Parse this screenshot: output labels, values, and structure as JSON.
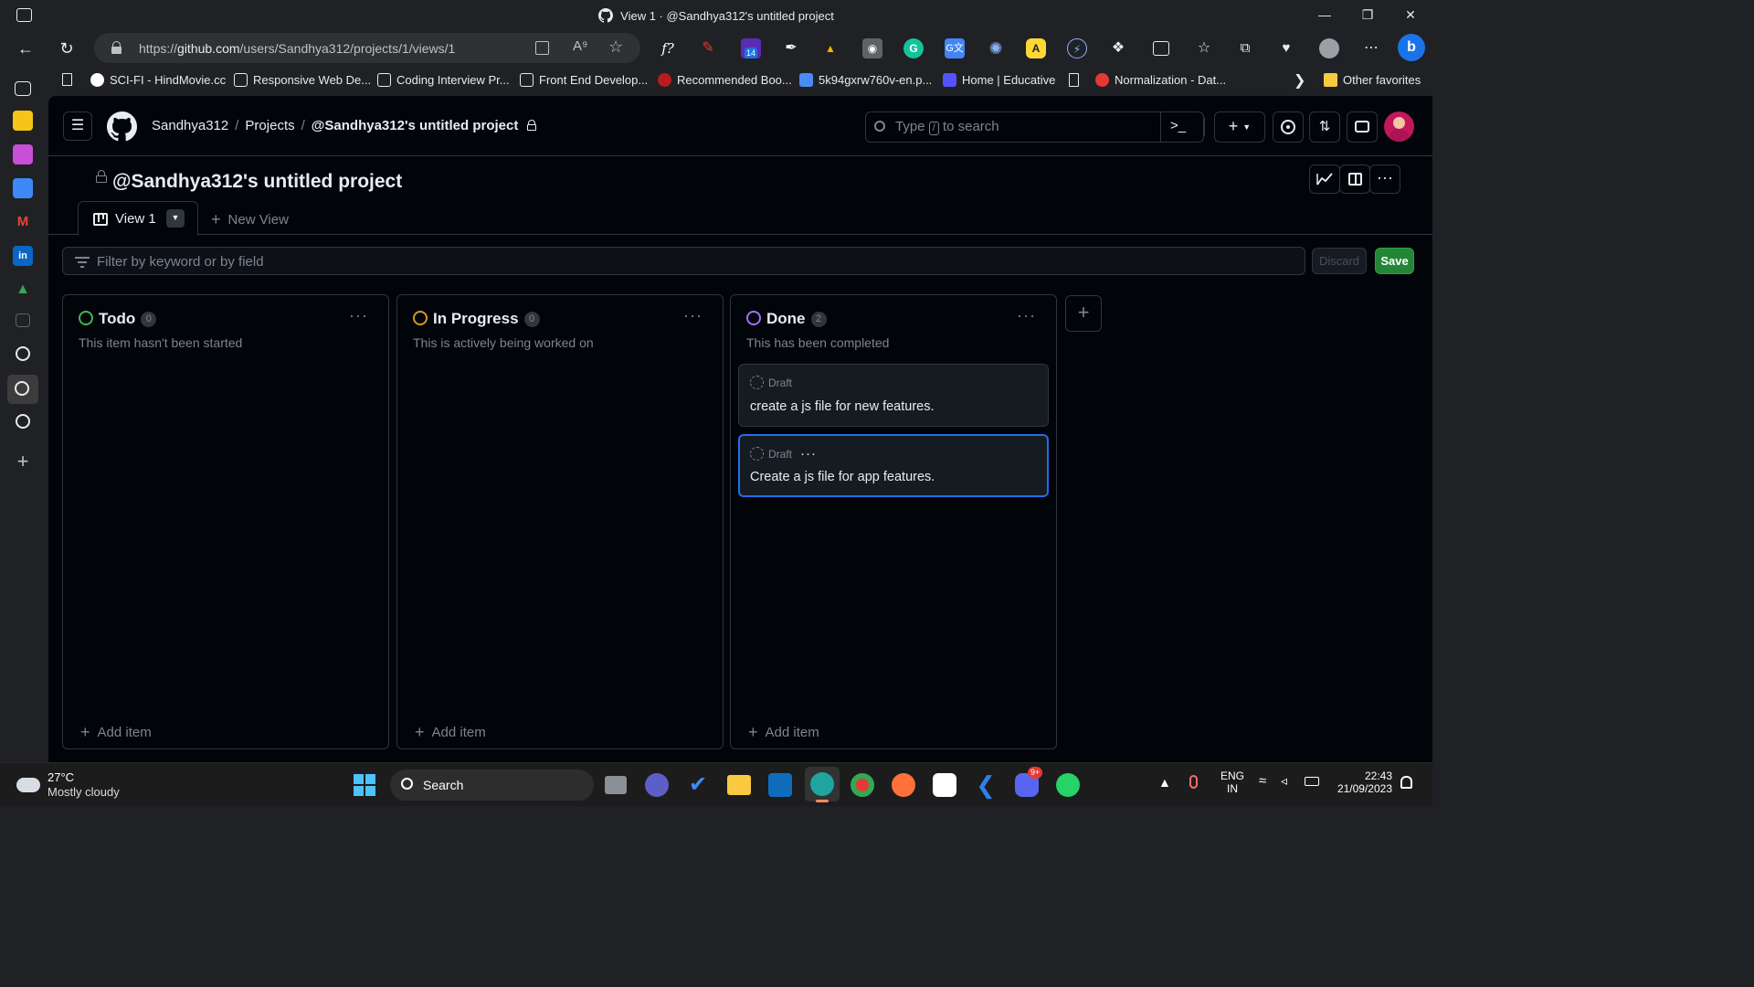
{
  "browser": {
    "tab_title": "View 1 · @Sandhya312's untitled project",
    "url_prefix": "https://",
    "url_host": "github.com",
    "url_path": "/users/Sandhya312/projects/1/views/1",
    "extension_badge": "14",
    "bookmarks": [
      "SCI-FI - HindMovie.cc",
      "Responsive Web De...",
      "Coding Interview Pr...",
      "Front End Develop...",
      "Recommended Boo...",
      "5k94gxrw760v-en.p...",
      "Home | Educative",
      "Normalization - Dat..."
    ],
    "other_favorites": "Other favorites"
  },
  "github": {
    "breadcrumb": {
      "owner": "Sandhya312",
      "section": "Projects",
      "project": "@Sandhya312's untitled project"
    },
    "search": {
      "prefix": "Type",
      "key": "/",
      "suffix": "to search"
    },
    "project_title": "@Sandhya312's untitled project",
    "tabs": {
      "view1": "View 1",
      "new_view": "New View"
    },
    "filter_placeholder": "Filter by keyword or by field",
    "discard_label": "Discard",
    "save_label": "Save",
    "columns": [
      {
        "name": "Todo",
        "count": "0",
        "description": "This item hasn't been started",
        "color": "#3fb950",
        "add_label": "Add item"
      },
      {
        "name": "In Progress",
        "count": "0",
        "description": "This is actively being worked on",
        "color": "#d29922",
        "add_label": "Add item"
      },
      {
        "name": "Done",
        "count": "2",
        "description": "This has been completed",
        "color": "#a371f7",
        "add_label": "Add item",
        "cards": [
          {
            "label": "Draft",
            "text": "create a js file for new features."
          },
          {
            "label": "Draft",
            "text": "Create a js file for app features."
          }
        ]
      }
    ]
  },
  "taskbar": {
    "weather_temp": "27°C",
    "weather_desc": "Mostly cloudy",
    "search_label": "Search",
    "lang_top": "ENG",
    "lang_bottom": "IN",
    "time": "22:43",
    "date": "21/09/2023",
    "notification_badge": "9+"
  }
}
